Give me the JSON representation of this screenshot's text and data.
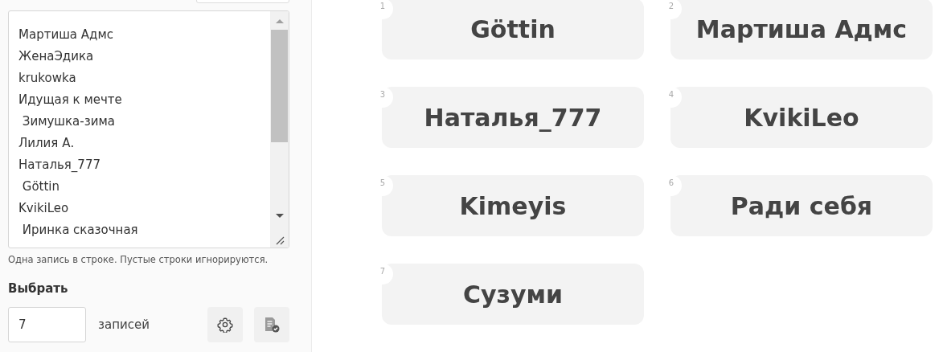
{
  "entries": {
    "lines": [
      "Мартиша Адмс",
      "ЖенаЭдика",
      "krukowka",
      "Идущая к мечте",
      " Зимушка-зима",
      "Лилия А.",
      "Наталья_777",
      " Göttin",
      "KvikiLeo",
      " Иринка сказочная"
    ],
    "hint": "Одна запись в строке. Пустые строки игнорируются."
  },
  "pick": {
    "label": "Выбрать",
    "count": "7",
    "unit": "записей"
  },
  "results": [
    {
      "number": "1",
      "name": "Göttin"
    },
    {
      "number": "2",
      "name": "Мартиша Адмс"
    },
    {
      "number": "3",
      "name": "Наталья_777"
    },
    {
      "number": "4",
      "name": "KvikiLeo"
    },
    {
      "number": "5",
      "name": "Kimeyis"
    },
    {
      "number": "6",
      "name": "Ради себя"
    },
    {
      "number": "7",
      "name": "Сузуми"
    }
  ]
}
